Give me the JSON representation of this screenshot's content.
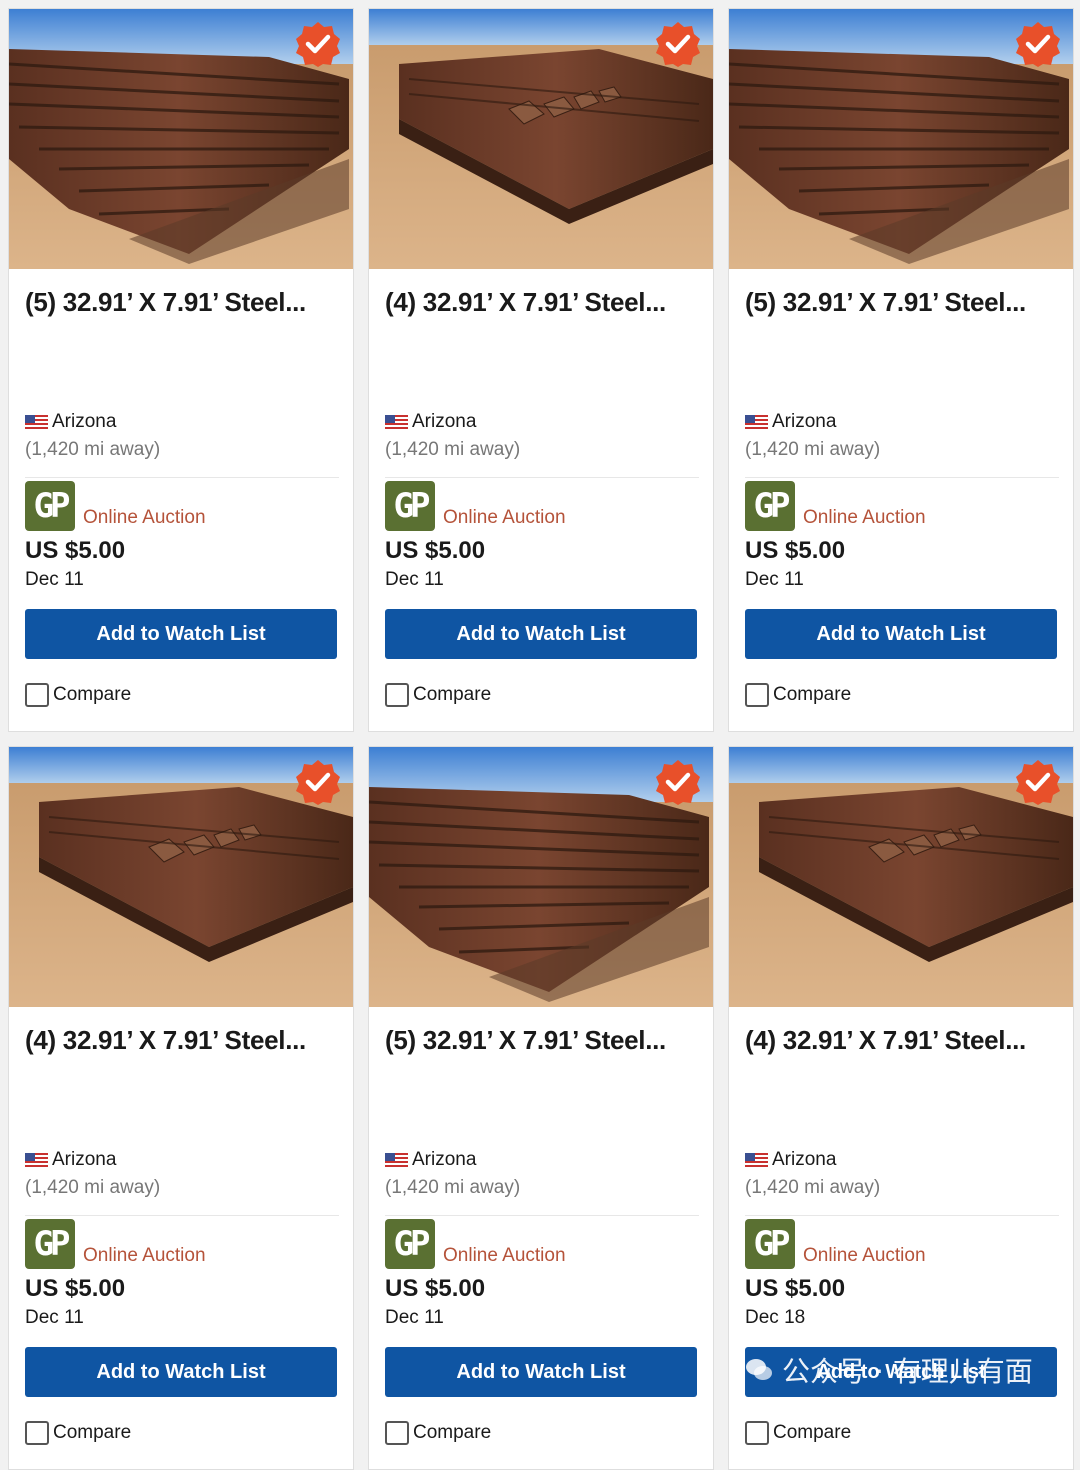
{
  "colors": {
    "accent": "#0f55a3",
    "auction": "#b5533a",
    "gp_badge": "#5a7032",
    "verified": "#e8502a"
  },
  "listings": [
    {
      "title": "(5) 32.91’ X 7.91’ Steel...",
      "location": "Arizona",
      "distance": "(1,420 mi away)",
      "seller_logo": "GP",
      "sale_type": "Online Auction",
      "price": "US $5.00",
      "date": "Dec 11",
      "button": "Add to Watch List",
      "compare": "Compare",
      "photo": "stacked steel rails in desert yard"
    },
    {
      "title": "(4) 32.91’ X 7.91’ Steel...",
      "location": "Arizona",
      "distance": "(1,420 mi away)",
      "seller_logo": "GP",
      "sale_type": "Online Auction",
      "price": "US $5.00",
      "date": "Dec 11",
      "button": "Add to Watch List",
      "compare": "Compare",
      "photo": "steel panels with ribs in desert yard"
    },
    {
      "title": "(5) 32.91’ X 7.91’ Steel...",
      "location": "Arizona",
      "distance": "(1,420 mi away)",
      "seller_logo": "GP",
      "sale_type": "Online Auction",
      "price": "US $5.00",
      "date": "Dec 11",
      "button": "Add to Watch List",
      "compare": "Compare",
      "photo": "stacked steel rails in desert yard"
    },
    {
      "title": "(4) 32.91’ X 7.91’ Steel...",
      "location": "Arizona",
      "distance": "(1,420 mi away)",
      "seller_logo": "GP",
      "sale_type": "Online Auction",
      "price": "US $5.00",
      "date": "Dec 11",
      "button": "Add to Watch List",
      "compare": "Compare",
      "photo": "steel panels with ribs in desert yard"
    },
    {
      "title": "(5) 32.91’ X 7.91’ Steel...",
      "location": "Arizona",
      "distance": "(1,420 mi away)",
      "seller_logo": "GP",
      "sale_type": "Online Auction",
      "price": "US $5.00",
      "date": "Dec 11",
      "button": "Add to Watch List",
      "compare": "Compare",
      "photo": "stacked steel rails in desert yard"
    },
    {
      "title": "(4) 32.91’ X 7.91’ Steel...",
      "location": "Arizona",
      "distance": "(1,420 mi away)",
      "seller_logo": "GP",
      "sale_type": "Online Auction",
      "price": "US $5.00",
      "date": "Dec 18",
      "button": "Add to Watch List",
      "compare": "Compare",
      "photo": "steel panels with ribs in desert yard"
    }
  ],
  "watermark": "公众号 · 有理儿有面"
}
